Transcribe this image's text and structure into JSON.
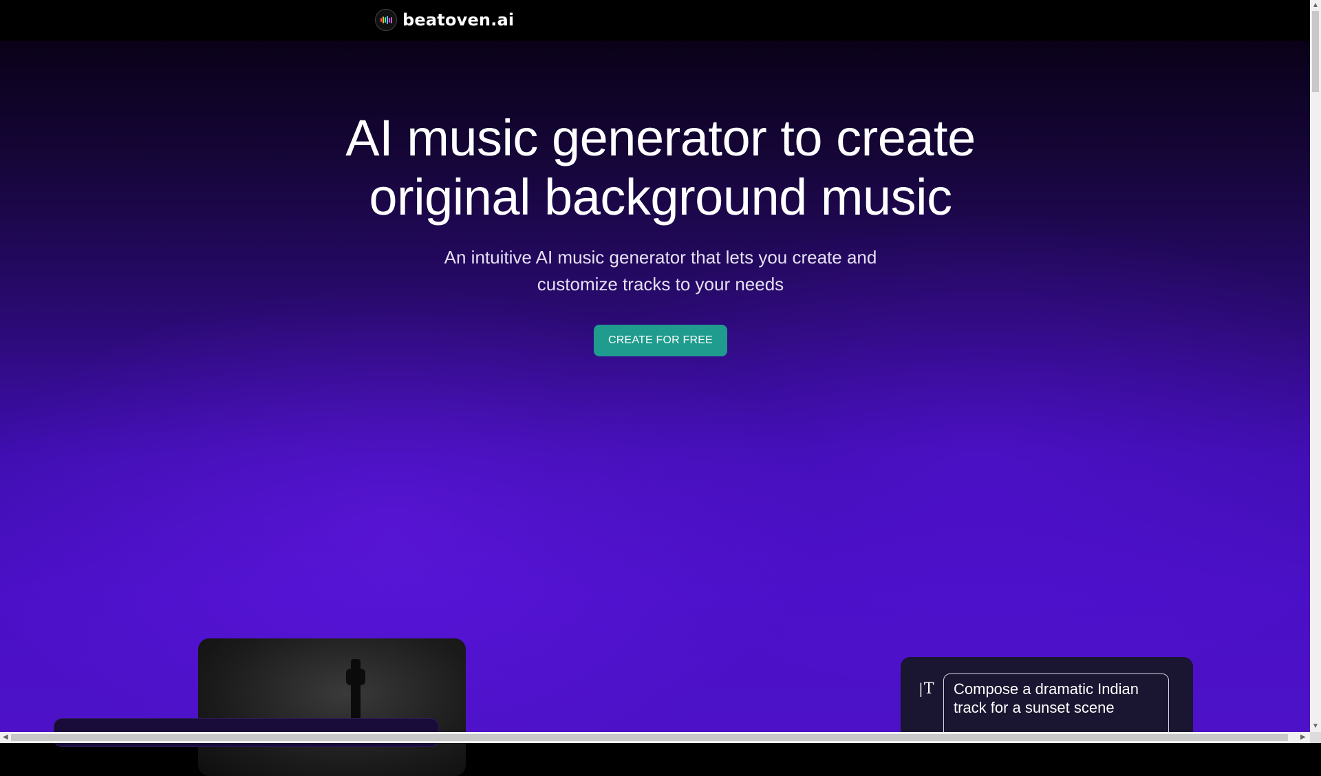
{
  "nav": {
    "logo_text": "beatoven.ai",
    "logo_icon": "waveform-logo-icon",
    "logo_bar_colors": [
      "#ff4d4d",
      "#ffb84d",
      "#4dff88",
      "#4dc3ff",
      "#b84dff",
      "#ff4dd2"
    ]
  },
  "hero": {
    "headline_line1": "AI music generator to create",
    "headline_line2": "original background music",
    "subtitle_line1": "An intuitive AI music generator that lets you create and",
    "subtitle_line2": "customize tracks to your needs",
    "cta_label": "CREATE FOR FREE"
  },
  "prompt_card": {
    "icon": "text-cursor-icon",
    "icon_label": "T",
    "prompt_text": "Compose a dramatic Indian track for a sunset scene"
  },
  "colors": {
    "accent": "#1f9c8e",
    "hero_top": "#0a0118",
    "hero_bottom": "#4d12c8"
  }
}
